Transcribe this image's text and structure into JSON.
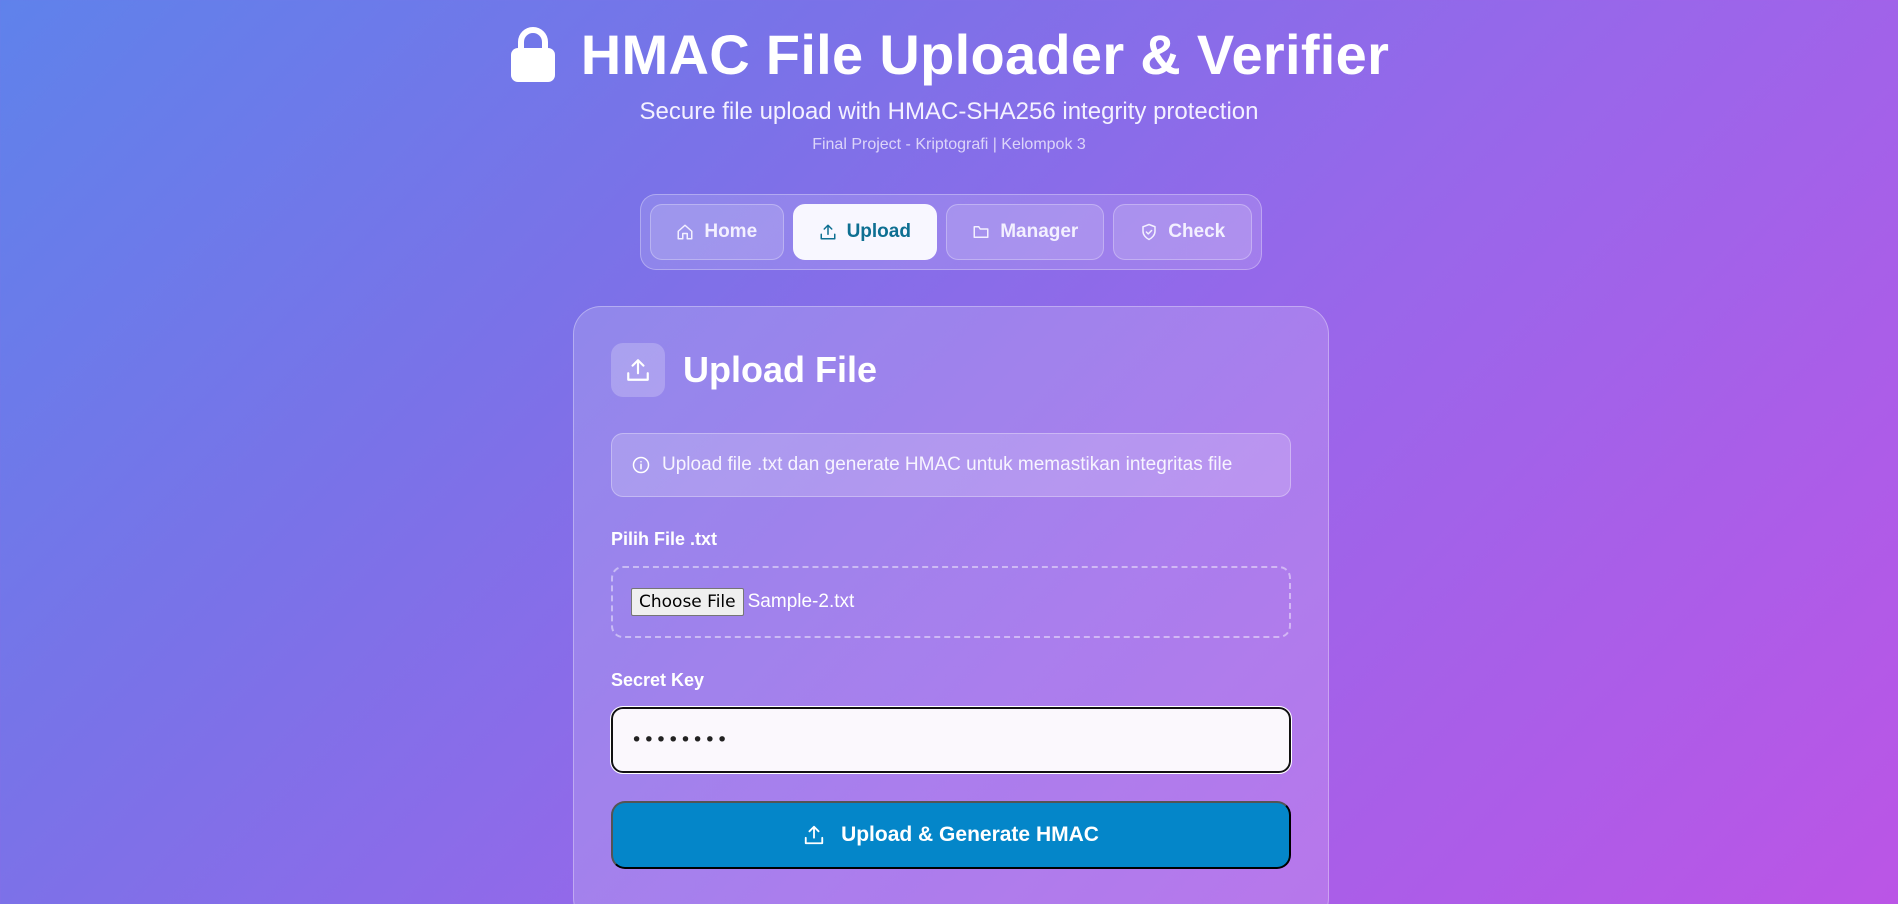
{
  "header": {
    "title": "HMAC File Uploader & Verifier",
    "subtitle": "Secure file upload with HMAC-SHA256 integrity protection",
    "meta": "Final Project - Kriptografi | Kelompok 3",
    "icon": "lock-icon"
  },
  "nav": {
    "tabs": [
      {
        "label": "Home",
        "icon": "home-icon",
        "active": false
      },
      {
        "label": "Upload",
        "icon": "upload-icon",
        "active": true
      },
      {
        "label": "Manager",
        "icon": "folder-icon",
        "active": false
      },
      {
        "label": "Check",
        "icon": "shield-check-icon",
        "active": false
      }
    ]
  },
  "upload": {
    "title": "Upload File",
    "info": "Upload file .txt dan generate HMAC untuk memastikan integritas file",
    "file_label": "Pilih File .txt",
    "file_button": "Choose File",
    "file_name": "Sample-2.txt",
    "key_label": "Secret Key",
    "key_value": "••••••••",
    "submit_label": "Upload & Generate HMAC"
  },
  "colors": {
    "accent": "#0486c9",
    "active_tab_text": "#0e6f92"
  }
}
